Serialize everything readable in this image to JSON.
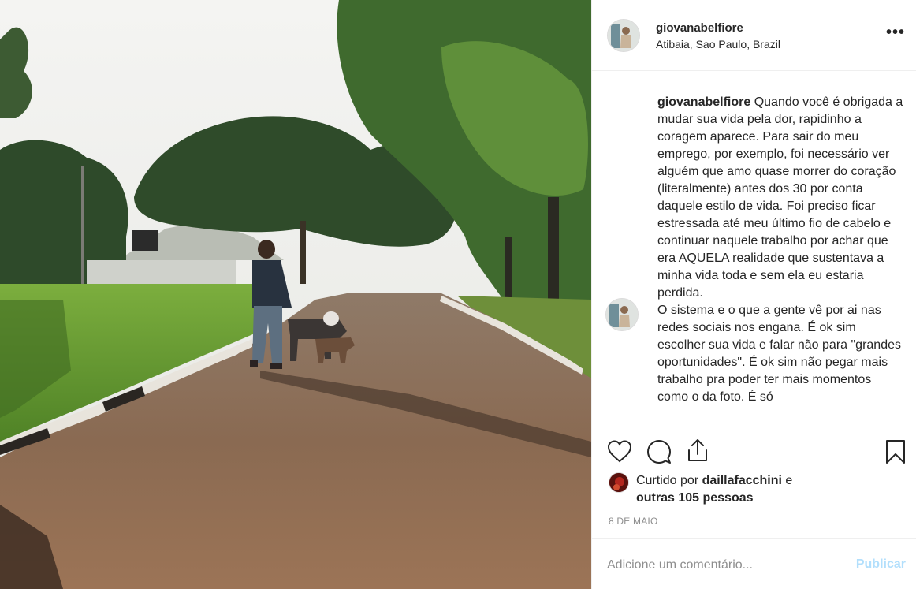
{
  "post": {
    "username": "giovanabelfiore",
    "location": "Atibaia, Sao Paulo, Brazil",
    "more_icon": "more-horizontal-icon"
  },
  "caption": {
    "username": "giovanabelfiore",
    "text": " Quando você é obrigada a mudar sua vida pela dor, rapidinho a coragem aparece. Para sair do meu emprego, por exemplo, foi necessário ver alguém que amo quase morrer do coração (literalmente) antes dos 30 por conta daquele estilo de vida. Foi preciso ficar estressada até meu último fio de cabelo e continuar naquele trabalho por achar que era AQUELA realidade que sustentava a minha vida toda e sem ela eu estaria perdida.\nO sistema e o que a gente vê por ai nas redes sociais nos engana. É ok sim escolher sua vida e falar não para \"grandes oportunidades\". É ok sim não pegar mais trabalho pra poder ter mais momentos como o da foto. É só"
  },
  "actions": {
    "icons": [
      "heart-icon",
      "comment-icon",
      "share-icon",
      "bookmark-icon"
    ]
  },
  "likes": {
    "prefix": "Curtido por ",
    "liker": "daillafacchini",
    "suffix": " e",
    "others": "outras 105 pessoas"
  },
  "date": "8 DE MAIO",
  "comment": {
    "placeholder": "Adicione um comentário...",
    "value": "",
    "post_label": "Publicar"
  },
  "colors": {
    "text": "#262626",
    "secondary": "#8e8e8e",
    "border": "#efefef",
    "post_disabled": "#b2dffc"
  }
}
